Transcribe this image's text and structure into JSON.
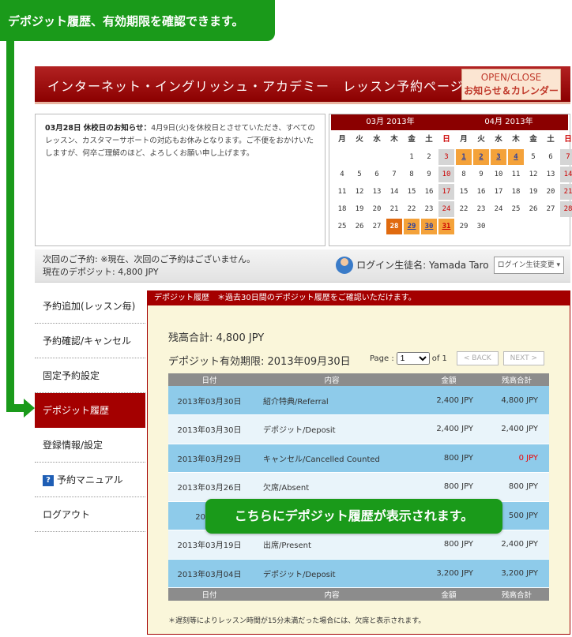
{
  "callout_top": "デポジット履歴、有効期限を確認できます。",
  "callout_table": "こちらにデポジット履歴が表示されます。",
  "header": {
    "title": "インターネット・イングリッシュ・アカデミー　レッスン予約ページ",
    "btn_line1": "OPEN/CLOSE",
    "btn_line2": "お知らせ＆カレンダー"
  },
  "notice": {
    "title": "03月28日 休校日のお知らせ：",
    "body": "4月9日(火)を休校日とさせていただき、すべてのレッスン、カスタマーサポートの対応もお休みとなります。ご不便をおかけいたしますが、何卒ご理解のほど、よろしくお願い申し上げます。"
  },
  "calendar": {
    "march_title": "03月 2013年",
    "april_title": "04月 2013年",
    "weekdays": [
      "月",
      "火",
      "水",
      "木",
      "金",
      "土",
      "日"
    ],
    "march": [
      "",
      "",
      "",
      "",
      "1",
      "2",
      "3",
      "4",
      "5",
      "6",
      "7",
      "8",
      "9",
      "10",
      "11",
      "12",
      "13",
      "14",
      "15",
      "16",
      "17",
      "18",
      "19",
      "20",
      "21",
      "22",
      "23",
      "24",
      "25",
      "26",
      "27",
      "28",
      "29",
      "30",
      "31"
    ],
    "april": [
      "1",
      "2",
      "3",
      "4",
      "5",
      "6",
      "7",
      "8",
      "9",
      "10",
      "11",
      "12",
      "13",
      "14",
      "15",
      "16",
      "17",
      "18",
      "19",
      "20",
      "21",
      "22",
      "23",
      "24",
      "25",
      "26",
      "27",
      "28",
      "29",
      "30"
    ],
    "march_today": "28",
    "march_available": [
      "29",
      "30",
      "31"
    ],
    "april_available": [
      "1",
      "2",
      "3",
      "4"
    ]
  },
  "status": {
    "next_lesson": "次回のご予約: ※現在、次回のご予約はございません。",
    "deposit": "現在のデポジット: 4,800 JPY",
    "login_label": "ログイン生徒名: Yamada Taro",
    "login_select": "ログイン生徒変更"
  },
  "sidebar": {
    "items": [
      "予約追加(レッスン毎)",
      "予約確認/キャンセル",
      "固定予約設定",
      "デポジット履歴",
      "登録情報/設定",
      "予約マニュアル",
      "ログアウト"
    ]
  },
  "panel": {
    "heading": "デポジット履歴　＊過去30日間のデポジット履歴をご確認いただけます。",
    "balance": "残高合計: 4,800 JPY",
    "expiry": "デポジット有効期限: 2013年09月30日",
    "pager_label": "Page :",
    "pager_value": "1",
    "pager_of": "of 1",
    "back": "< BACK",
    "next": "NEXT >",
    "columns": [
      "日付",
      "内容",
      "金額",
      "残高合計"
    ],
    "rows": [
      {
        "date": "2013年03月30日",
        "desc": "紹介特典/Referral",
        "amount": "2,400 JPY",
        "balance": "4,800 JPY"
      },
      {
        "date": "2013年03月30日",
        "desc": "デポジット/Deposit",
        "amount": "2,400 JPY",
        "balance": "2,400 JPY"
      },
      {
        "date": "2013年03月29日",
        "desc": "キャンセル/Cancelled Counted",
        "amount": "800 JPY",
        "balance": "0 JPY"
      },
      {
        "date": "2013年03月26日",
        "desc": "欠席/Absent",
        "amount": "800 JPY",
        "balance": "800 JPY"
      },
      {
        "date": "2013年",
        "desc": "",
        "amount": "",
        "balance": "500 JPY"
      },
      {
        "date": "2013年03月19日",
        "desc": "出席/Present",
        "amount": "800 JPY",
        "balance": "2,400 JPY"
      },
      {
        "date": "2013年03月04日",
        "desc": "デポジット/Deposit",
        "amount": "3,200 JPY",
        "balance": "3,200 JPY"
      }
    ],
    "footnote": "＊遅刻等によりレッスン時間が15分未満だった場合には、欠席と表示されます。"
  },
  "colors": {
    "brand_red": "#a40000",
    "guide_green": "#1a9a1a",
    "row_blue": "#8ecbea"
  }
}
